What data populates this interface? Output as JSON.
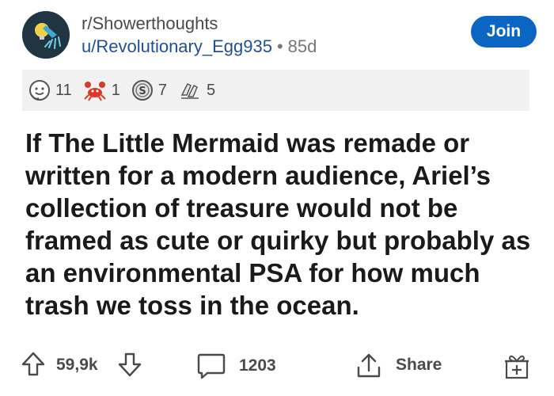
{
  "post": {
    "subreddit": "r/Showerthoughts",
    "author": "u/Revolutionary_Egg935",
    "separator": "•",
    "age": "85d",
    "join_label": "Join",
    "title": "If The Little Mermaid was remade or written for a modern audience, Ariel’s collection of treasure would not be framed as cute or quirky but probably as an environmental PSA for how much trash we toss in the ocean."
  },
  "awards": [
    {
      "icon": "wholesome-award-icon",
      "count": "11"
    },
    {
      "icon": "crab-award-icon",
      "count": "1"
    },
    {
      "icon": "silver-coin-award-icon",
      "count": "7"
    },
    {
      "icon": "hands-award-icon",
      "count": "5"
    }
  ],
  "actions": {
    "score": "59,9k",
    "comments": "1203",
    "share_label": "Share"
  },
  "colors": {
    "join_button": "#0a66c2",
    "username": "#1f4f9a",
    "awards_bar": "#f1f1f1",
    "avatar_bg": "#1f3542"
  }
}
